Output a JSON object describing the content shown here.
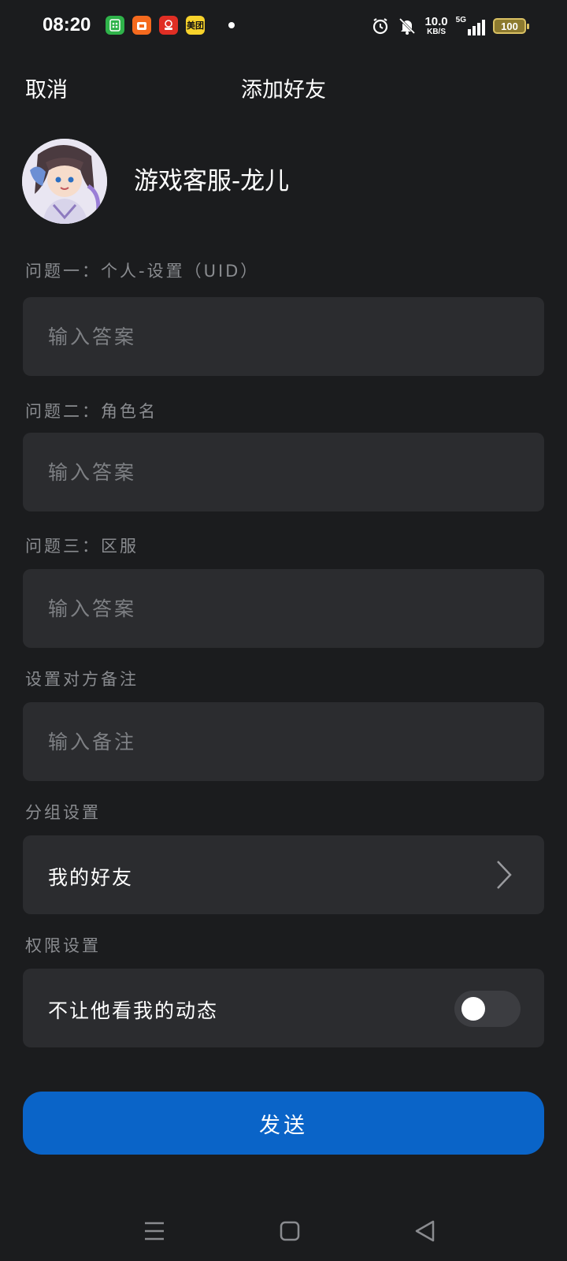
{
  "status_bar": {
    "time": "08:20",
    "app_icons": [
      {
        "name": "wechat-mini-icon",
        "color": "#2fb34a"
      },
      {
        "name": "orange-store-icon",
        "color": "#f56a1e"
      },
      {
        "name": "pinduoduo-icon",
        "color": "#e02e24"
      },
      {
        "name": "meituan-icon",
        "color": "#f7d22b",
        "text": "美团"
      }
    ],
    "speed_value": "10.0",
    "speed_unit": "KB/S",
    "network": "5G",
    "battery": "100"
  },
  "header": {
    "cancel_label": "取消",
    "title": "添加好友"
  },
  "profile": {
    "name": "游戏客服-龙儿"
  },
  "questions": [
    {
      "label": "问题一：个人-设置（UID）",
      "placeholder": "输入答案"
    },
    {
      "label": "问题二：角色名",
      "placeholder": "输入答案"
    },
    {
      "label": "问题三：区服",
      "placeholder": "输入答案"
    }
  ],
  "remark": {
    "label": "设置对方备注",
    "placeholder": "输入备注"
  },
  "group": {
    "label": "分组设置",
    "value": "我的好友"
  },
  "permission": {
    "label": "权限设置",
    "option": "不让他看我的动态",
    "enabled": false
  },
  "send_label": "发送"
}
